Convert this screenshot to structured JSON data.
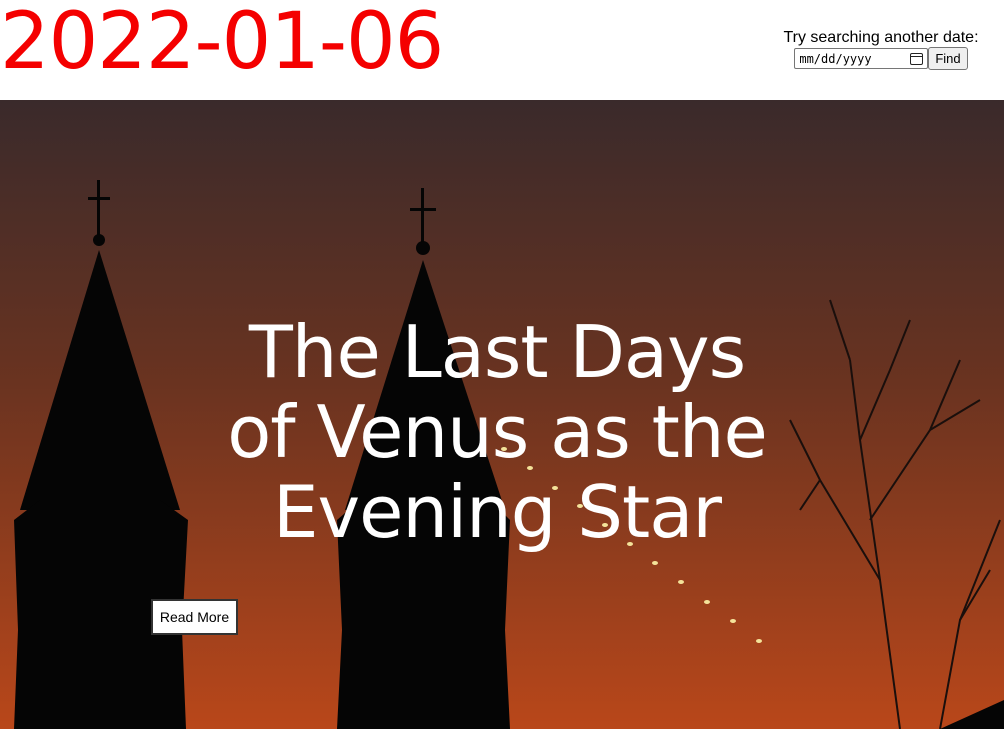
{
  "header": {
    "date": "2022-01-06",
    "search_label": "Try searching another date:",
    "date_placeholder": "mm/dd/yyyy",
    "find_label": "Find"
  },
  "hero": {
    "title": "The Last Days of Venus as the Evening Star",
    "read_more_label": "Read More"
  },
  "colors": {
    "date_title": "#f40000",
    "sky_top": "#3a2a2b",
    "sky_bottom": "#b9471a"
  }
}
